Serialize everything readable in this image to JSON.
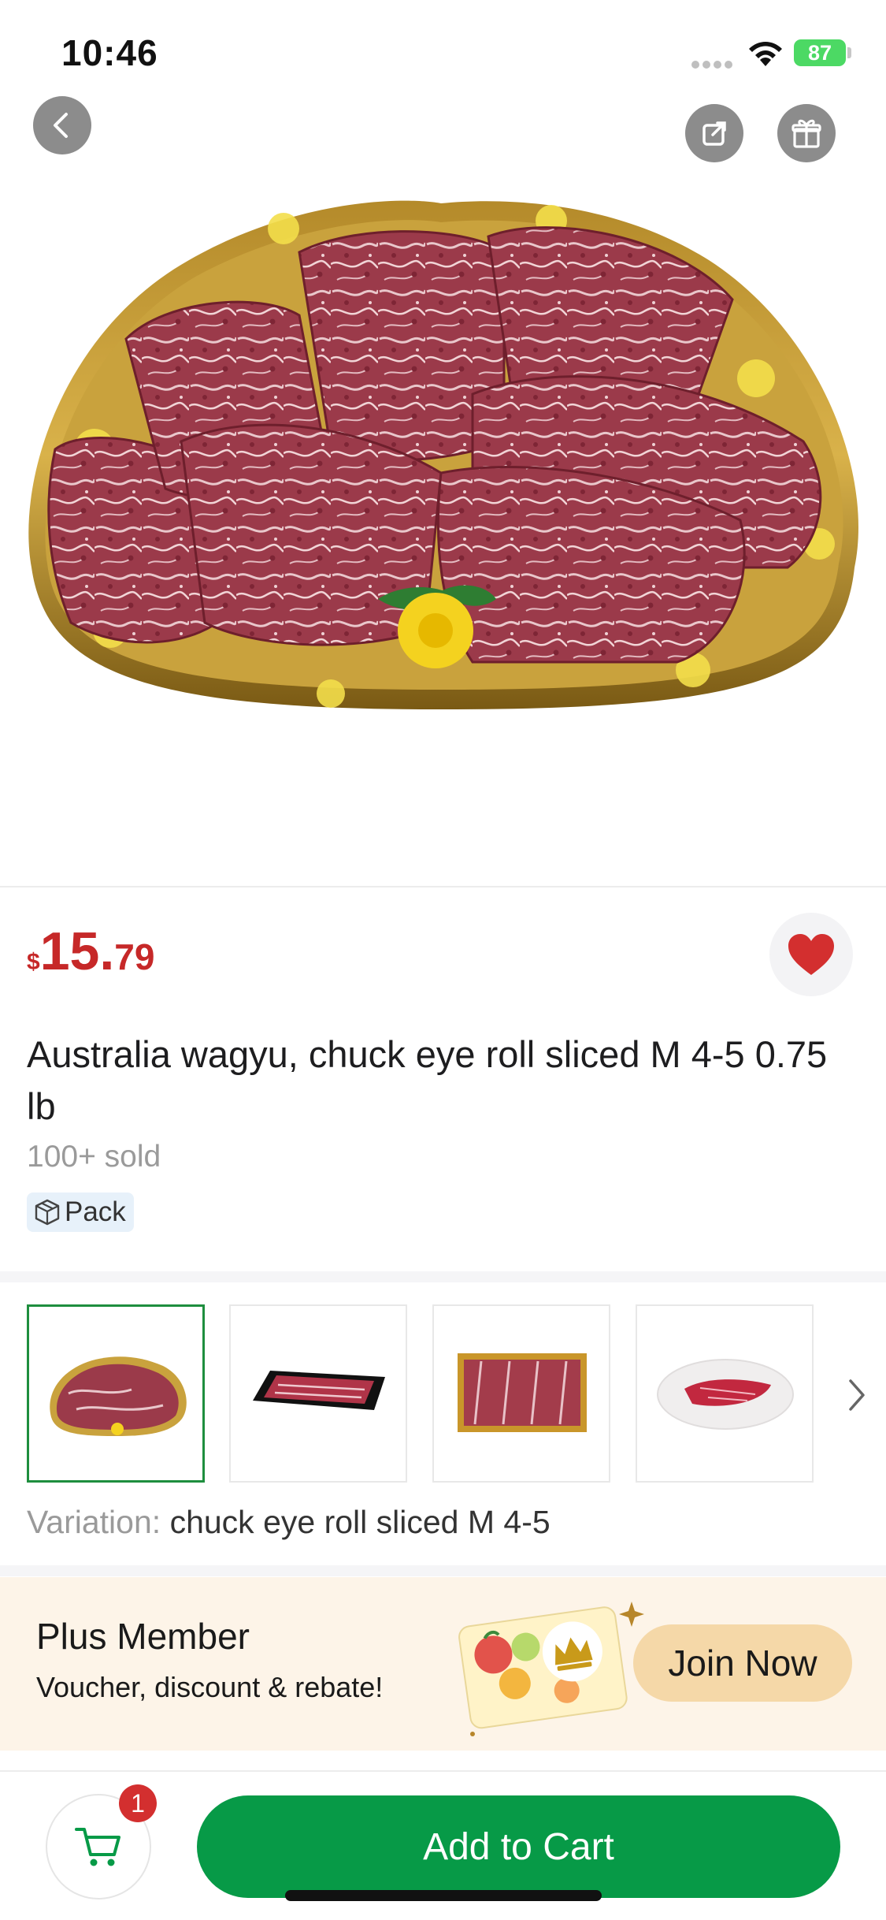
{
  "status_bar": {
    "time": "10:46",
    "battery": "87"
  },
  "product": {
    "price": {
      "currency": "$",
      "integer": "15",
      "dot": ".",
      "decimal": "79"
    },
    "title": "Australia wagyu, chuck eye roll sliced M 4-5 0.75 lb",
    "sold": "100+ sold",
    "tag": "Pack",
    "favorited": true
  },
  "variation": {
    "label": "Variation:",
    "value": "chuck eye roll sliced M 4-5"
  },
  "thumbnails": [
    {
      "name": "tray-half-round",
      "selected": true
    },
    {
      "name": "black-rect-tray",
      "selected": false
    },
    {
      "name": "gold-rect-tray",
      "selected": false
    },
    {
      "name": "white-plate",
      "selected": false
    }
  ],
  "plus_banner": {
    "title": "Plus Member",
    "subtitle": "Voucher, discount & rebate!",
    "button": "Join Now"
  },
  "bottom_bar": {
    "cart_count": "1",
    "add_to_cart": "Add to Cart"
  },
  "colors": {
    "price": "#c62828",
    "primary_green": "#079a47",
    "plus_bg": "#fdf4e8",
    "join_button": "#f5d8a8",
    "badge": "#d32f2f"
  },
  "icons": [
    "back-icon",
    "share-icon",
    "gift-icon",
    "heart-icon",
    "pack-box-icon",
    "chevron-right-icon",
    "cart-icon",
    "wifi-icon",
    "signal-icon",
    "battery-icon",
    "crown-icon"
  ]
}
